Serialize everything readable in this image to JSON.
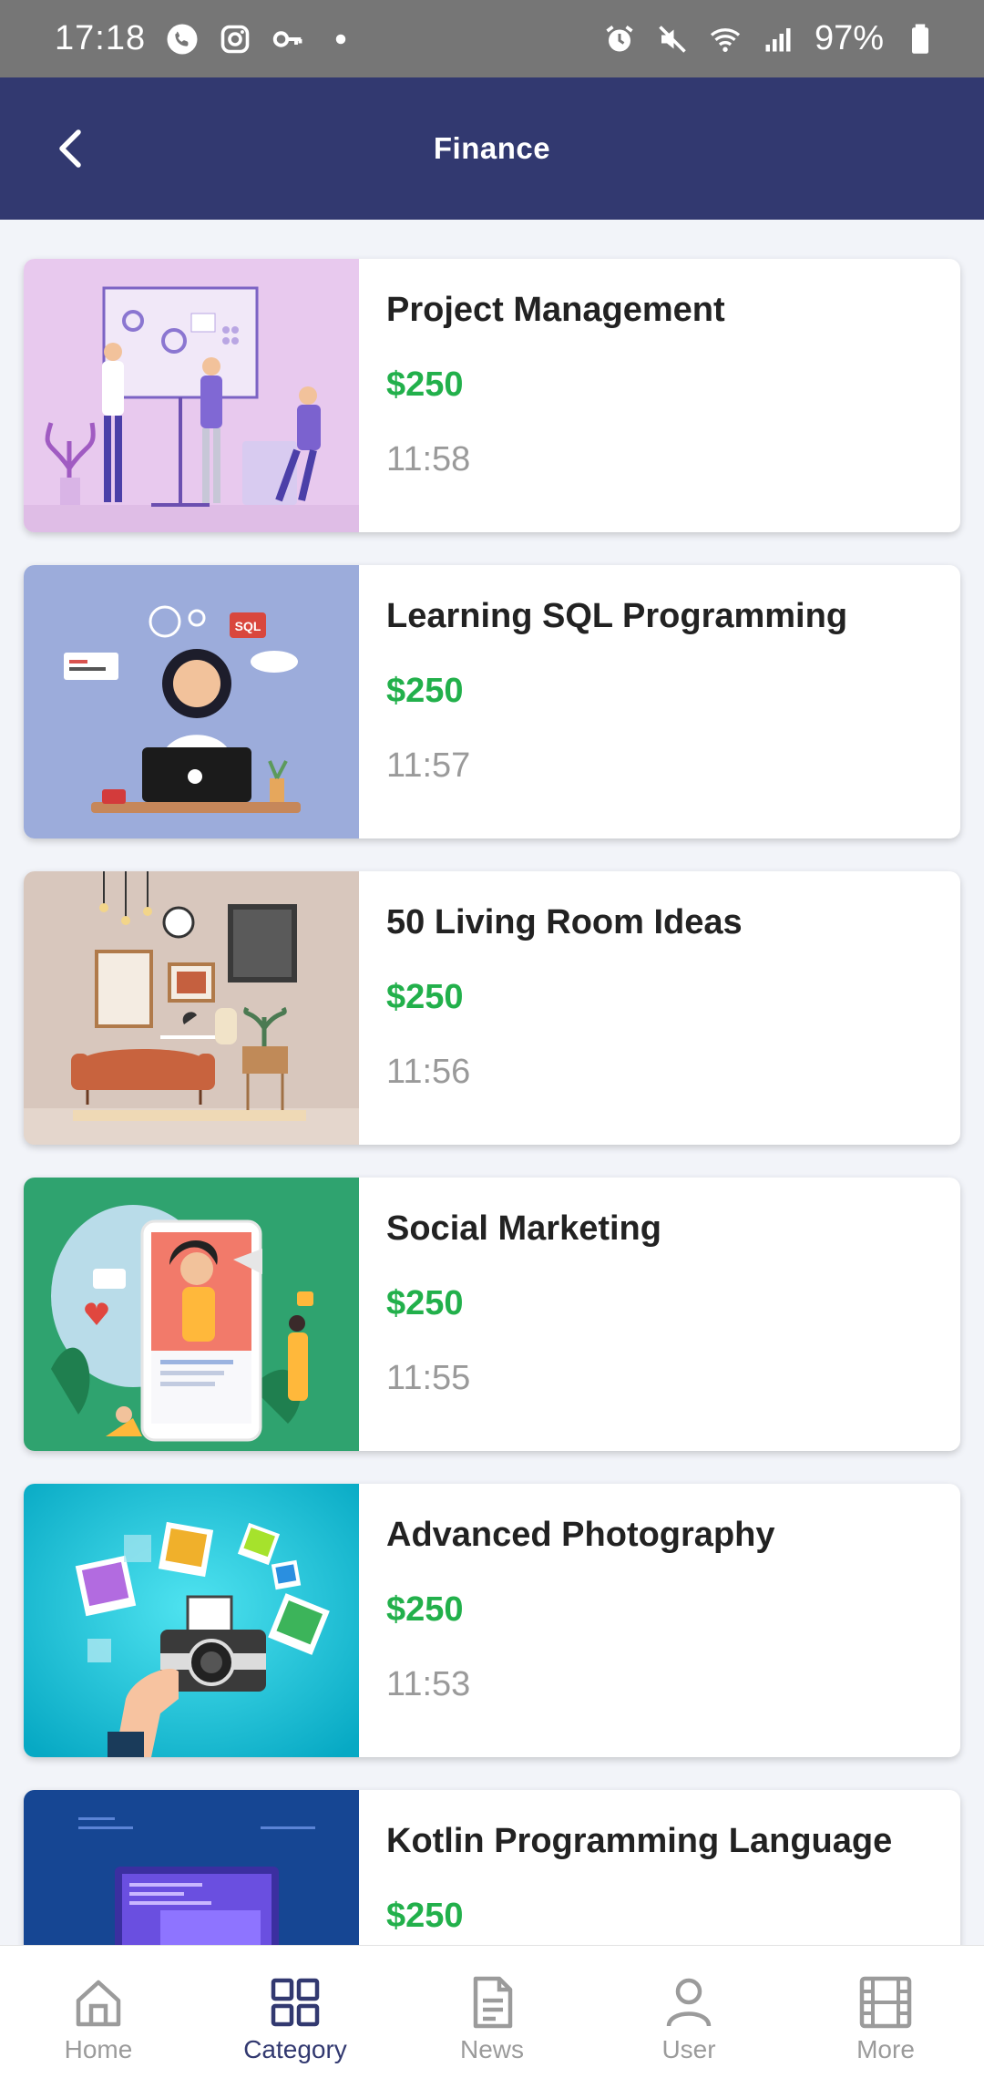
{
  "status_bar": {
    "time": "17:18",
    "battery": "97%",
    "icons_left": [
      "phone-icon",
      "instagram-icon",
      "key-icon",
      "dot-icon"
    ],
    "icons_right": [
      "alarm-icon",
      "mute-icon",
      "wifi-icon",
      "signal-icon",
      "battery-icon"
    ]
  },
  "app_bar": {
    "title": "Finance",
    "back_icon": "chevron-left-icon",
    "color": "#323970"
  },
  "courses": [
    {
      "title": "Project Management",
      "price": "$250",
      "time": "11:58",
      "image": "project-management-illustration"
    },
    {
      "title": "Learning SQL Programming",
      "price": "$250",
      "time": "11:57",
      "image": "sql-programming-illustration"
    },
    {
      "title": "50 Living Room Ideas",
      "price": "$250",
      "time": "11:56",
      "image": "living-room-illustration"
    },
    {
      "title": "Social Marketing",
      "price": "$250",
      "time": "11:55",
      "image": "social-marketing-illustration"
    },
    {
      "title": "Advanced Photography",
      "price": "$250",
      "time": "11:53",
      "image": "photography-illustration"
    },
    {
      "title": "Kotlin Programming Language",
      "price": "$250",
      "time": "",
      "image": "kotlin-illustration"
    }
  ],
  "bottom_nav": {
    "items": [
      {
        "label": "Home",
        "icon": "home-icon",
        "active": false
      },
      {
        "label": "Category",
        "icon": "grid-icon",
        "active": true
      },
      {
        "label": "News",
        "icon": "document-icon",
        "active": false
      },
      {
        "label": "User",
        "icon": "user-icon",
        "active": false
      },
      {
        "label": "More",
        "icon": "film-icon",
        "active": false
      }
    ]
  },
  "colors": {
    "primary": "#323970",
    "price": "#22b04b",
    "muted": "#9a9a9a",
    "background": "#f2f4f9"
  }
}
